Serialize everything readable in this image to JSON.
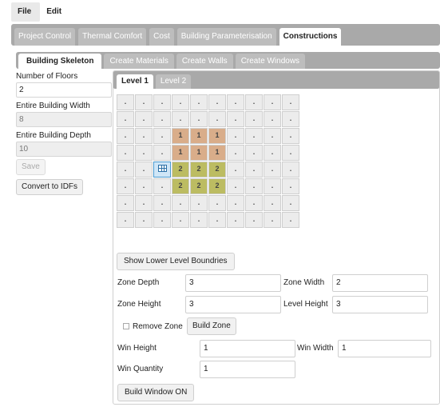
{
  "menu": {
    "file": "File",
    "edit": "Edit"
  },
  "main_tabs": [
    "Project Control",
    "Thermal Comfort",
    "Cost",
    "Building Parameterisation",
    "Constructions"
  ],
  "sub_tabs": [
    "Building Skeleton",
    "Create Materials",
    "Create Walls",
    "Create Windows"
  ],
  "left": {
    "floors_label": "Number of Floors",
    "floors_value": "2",
    "width_label": "Entire Building Width",
    "width_value": "8",
    "depth_label": "Entire Building Depth",
    "depth_value": "10",
    "save_label": "Save",
    "convert_label": "Convert to IDFs"
  },
  "levels": [
    "Level 1",
    "Level 2"
  ],
  "grid": {
    "rows": [
      [
        ".",
        ".",
        ".",
        ".",
        ".",
        ".",
        ".",
        ".",
        ".",
        "."
      ],
      [
        ".",
        ".",
        ".",
        ".",
        ".",
        ".",
        ".",
        ".",
        ".",
        "."
      ],
      [
        ".",
        ".",
        ".",
        "1",
        "1",
        "1",
        ".",
        ".",
        ".",
        "."
      ],
      [
        ".",
        ".",
        ".",
        "1",
        "1",
        "1",
        ".",
        ".",
        ".",
        "."
      ],
      [
        ".",
        ".",
        "#",
        "2",
        "2",
        "2",
        ".",
        ".",
        ".",
        "."
      ],
      [
        ".",
        ".",
        ".",
        "2",
        "2",
        "2",
        ".",
        ".",
        ".",
        "."
      ],
      [
        ".",
        ".",
        ".",
        ".",
        ".",
        ".",
        ".",
        ".",
        ".",
        "."
      ],
      [
        ".",
        ".",
        ".",
        ".",
        ".",
        ".",
        ".",
        ".",
        ".",
        "."
      ]
    ],
    "zone_colors": {
      "1": "#d9ad8a",
      "2": "#bcbc62"
    },
    "selected_icon": "grid-table-icon"
  },
  "show_lower_label": "Show Lower Level Boundries",
  "zone": {
    "depth_label": "Zone Depth",
    "depth_value": "3",
    "width_label": "Zone Width",
    "width_value": "2",
    "height_label": "Zone Height",
    "height_value": "3",
    "level_height_label": "Level Height",
    "level_height_value": "3",
    "remove_label": "Remove Zone",
    "build_label": "Build Zone"
  },
  "window": {
    "height_label": "Win Height",
    "height_value": "1",
    "width_label": "Win Width",
    "width_value": "1",
    "quantity_label": "Win Quantity",
    "quantity_value": "1",
    "build_label": "Build Window ON"
  }
}
